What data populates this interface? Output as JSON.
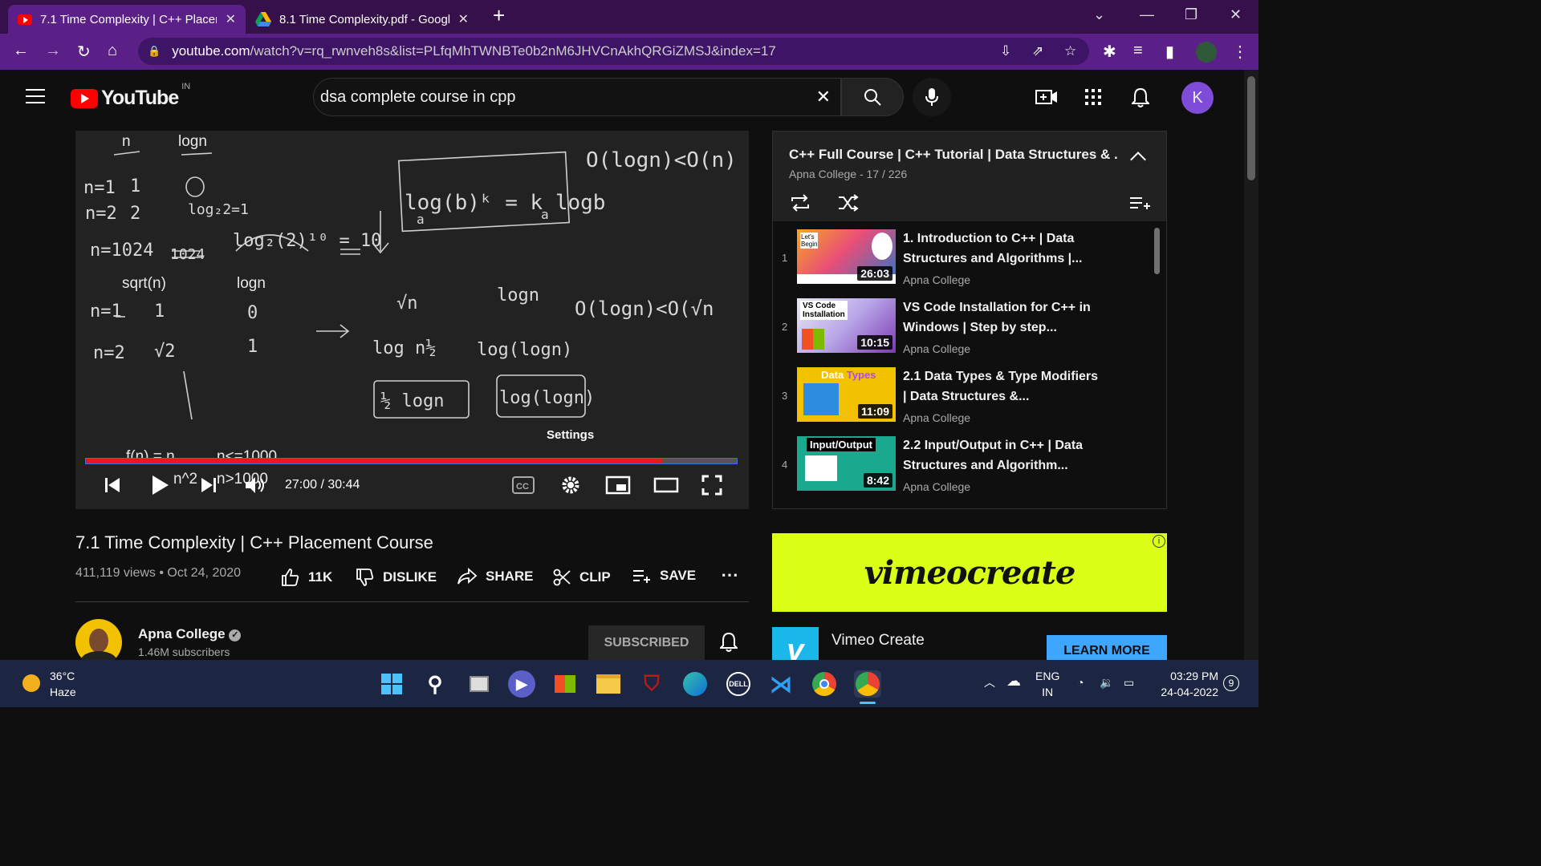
{
  "browser": {
    "tabs": [
      {
        "title": "7.1 Time Complexity | C++ Placer"
      },
      {
        "title": "8.1 Time Complexity.pdf - Googl"
      }
    ],
    "url_domain": "youtube.com",
    "url_path": "/watch?v=rq_rwnveh8s&list=PLfqMhTWNBTe0b2nM6JHVCnAkhQRGiZMSJ&index=17"
  },
  "youtube": {
    "logo_text": "YouTube",
    "region": "IN",
    "search_value": "dsa complete course in cpp",
    "avatar_letter": "K"
  },
  "player": {
    "board": {
      "col1_a": "n",
      "col1_b": "logn",
      "col2_a": "sqrt(n)",
      "col2_b": "logn",
      "bottom_a": "f(n) = n",
      "bottom_b": "n<=1000",
      "bottom_c": "n^2",
      "bottom_d": "n>1000"
    },
    "tooltip": "Settings",
    "progress": 0.885,
    "time_label": "27:00 / 30:44"
  },
  "video": {
    "title": "7.1 Time Complexity | C++ Placement Course",
    "views": "411,119 views",
    "date": "Oct 24, 2020",
    "likes": "11K",
    "dislike": "DISLIKE",
    "share": "SHARE",
    "clip": "CLIP",
    "save": "SAVE",
    "channel": "Apna College",
    "subscribers": "1.46M subscribers",
    "subscribed": "SUBSCRIBED"
  },
  "playlist": {
    "title": "C++ Full Course |  C++ Tutorial | Data Structures & ...",
    "channel": "Apna College",
    "position": "17 / 226",
    "items": [
      {
        "num": "1",
        "title": "1. Introduction to C++ | Data Structures and Algorithms |...",
        "channel": "Apna College",
        "duration": "26:03"
      },
      {
        "num": "2",
        "title": "VS Code Installation for C++ in Windows | Step by step...",
        "channel": "Apna College",
        "duration": "10:15"
      },
      {
        "num": "3",
        "title": "2.1 Data Types & Type Modifiers | Data Structures &...",
        "channel": "Apna College",
        "duration": "11:09"
      },
      {
        "num": "4",
        "title": "2.2 Input/Output in C++ | Data Structures and Algorithm...",
        "channel": "Apna College",
        "duration": "8:42"
      }
    ]
  },
  "ad": {
    "banner": "vimeocreate",
    "name": "Vimeo Create",
    "cta": "LEARN MORE"
  },
  "taskbar": {
    "temp": "36°C",
    "weather": "Haze",
    "lang": "ENG",
    "region": "IN",
    "time": "03:29 PM",
    "date": "24-04-2022",
    "notifications": "9"
  }
}
